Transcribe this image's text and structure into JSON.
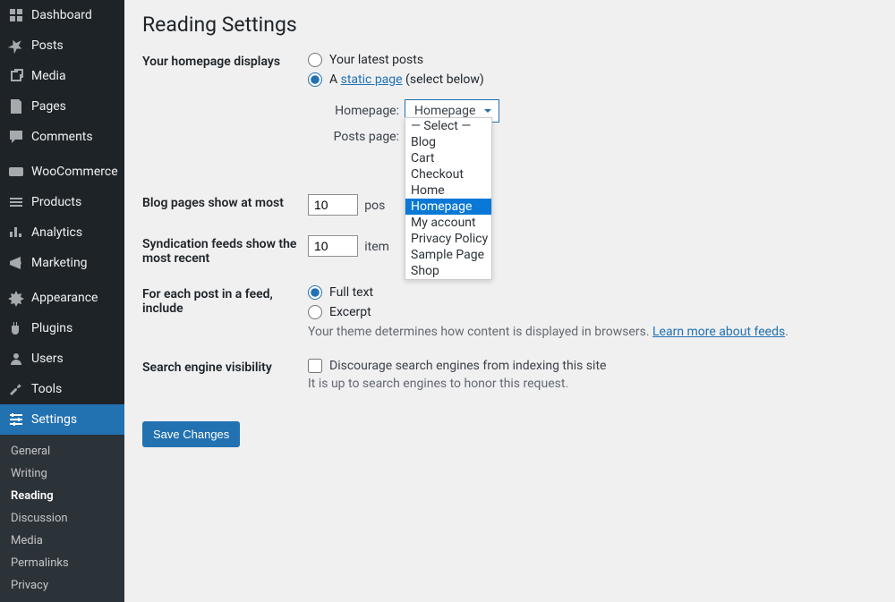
{
  "sidebar": [
    {
      "label": "Dashboard",
      "icon": "dashboard"
    },
    {
      "label": "Posts",
      "icon": "pin"
    },
    {
      "label": "Media",
      "icon": "media"
    },
    {
      "label": "Pages",
      "icon": "page"
    },
    {
      "label": "Comments",
      "icon": "comment"
    },
    {
      "label": "WooCommerce",
      "icon": "woo"
    },
    {
      "label": "Products",
      "icon": "products"
    },
    {
      "label": "Analytics",
      "icon": "analytics"
    },
    {
      "label": "Marketing",
      "icon": "marketing"
    },
    {
      "label": "Appearance",
      "icon": "appearance"
    },
    {
      "label": "Plugins",
      "icon": "plugin"
    },
    {
      "label": "Users",
      "icon": "users"
    },
    {
      "label": "Tools",
      "icon": "tools"
    },
    {
      "label": "Settings",
      "icon": "settings",
      "active": true
    }
  ],
  "submenu": [
    "General",
    "Writing",
    "Reading",
    "Discussion",
    "Media",
    "Permalinks",
    "Privacy"
  ],
  "submenuActive": "Reading",
  "page": {
    "title": "Reading Settings",
    "homepage_label": "Your homepage displays",
    "radio_latest": "Your latest posts",
    "radio_static_prefix": "A ",
    "radio_static_link": "static page",
    "radio_static_suffix": " (select below)",
    "homepage_select_label": "Homepage:",
    "homepage_select_value": "Homepage",
    "posts_page_label": "Posts page:",
    "dropdown_options": [
      "— Select —",
      "Blog",
      "Cart",
      "Checkout",
      "Home",
      "Homepage",
      "My account",
      "Privacy Policy",
      "Sample Page",
      "Shop"
    ],
    "dropdown_highlighted": "Homepage",
    "blog_pages_label": "Blog pages show at most",
    "blog_pages_value": "10",
    "blog_pages_unit": "pos",
    "syndication_label": "Syndication feeds show the most recent",
    "syndication_value": "10",
    "syndication_unit": "item",
    "feed_label": "For each post in a feed, include",
    "feed_full": "Full text",
    "feed_excerpt": "Excerpt",
    "feed_desc_prefix": "Your theme determines how content is displayed in browsers. ",
    "feed_desc_link": "Learn more about feeds",
    "feed_desc_suffix": ".",
    "visibility_label": "Search engine visibility",
    "visibility_checkbox": "Discourage search engines from indexing this site",
    "visibility_desc": "It is up to search engines to honor this request.",
    "save_button": "Save Changes"
  }
}
